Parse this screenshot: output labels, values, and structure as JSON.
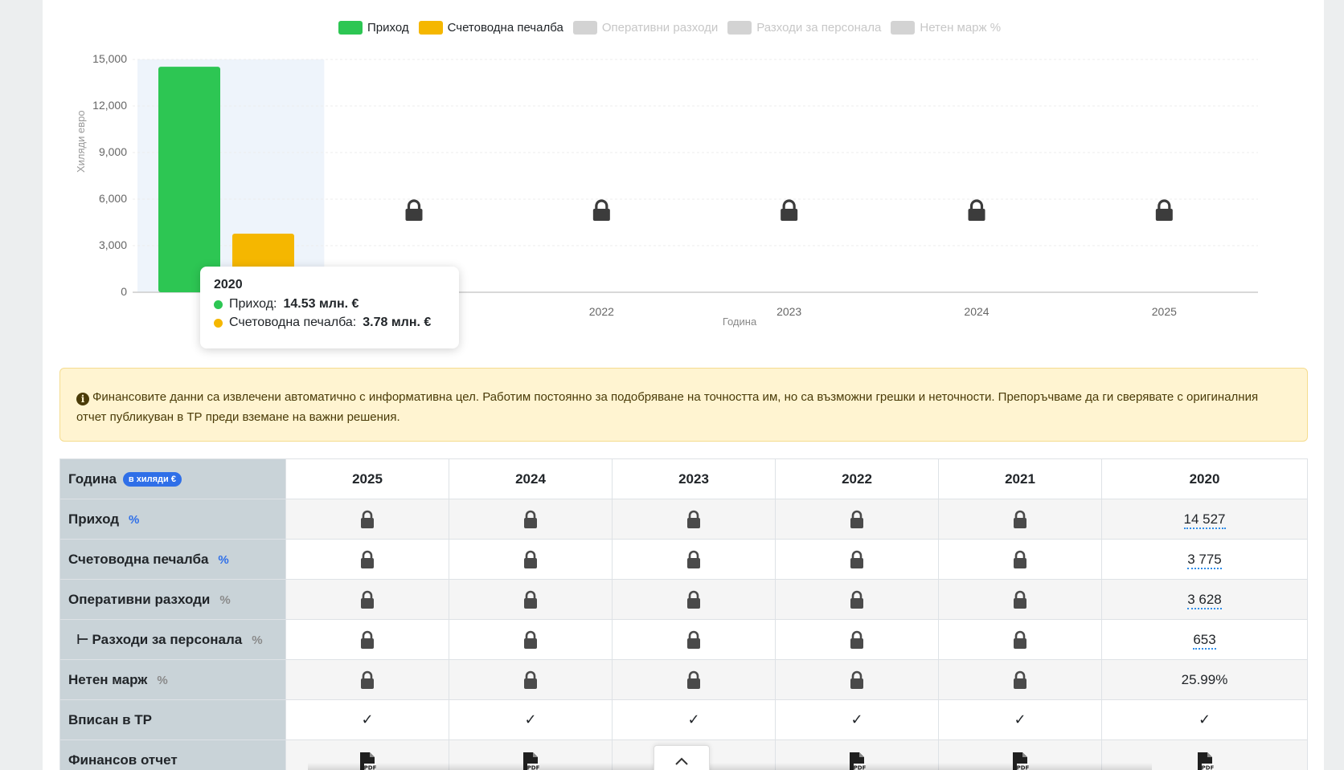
{
  "legend": [
    {
      "label": "Приход",
      "color": "#2dc653",
      "active": true
    },
    {
      "label": "Счетоводна печалба",
      "color": "#f5b700",
      "active": true
    },
    {
      "label": "Оперативни разходи",
      "color": "#d3d3d3",
      "active": false
    },
    {
      "label": "Разходи за персонала",
      "color": "#d3d3d3",
      "active": false
    },
    {
      "label": "Нетен марж %",
      "color": "#d3d3d3",
      "active": false
    }
  ],
  "chart_data": {
    "type": "bar",
    "categories": [
      "2020",
      "2021",
      "2022",
      "2023",
      "2024",
      "2025"
    ],
    "x_tick_labels": [
      "",
      "",
      "2022",
      "2023",
      "2024",
      "2025"
    ],
    "series": [
      {
        "name": "Приход",
        "values": [
          14527,
          null,
          null,
          null,
          null,
          null
        ],
        "color": "#2dc653"
      },
      {
        "name": "Счетоводна печалба",
        "values": [
          3775,
          null,
          null,
          null,
          null,
          null
        ],
        "color": "#f5b700"
      }
    ],
    "locked_categories": [
      "2021",
      "2022",
      "2023",
      "2024",
      "2025"
    ],
    "ylabel": "Хиляди евро",
    "xlabel": "Година",
    "ylim": [
      0,
      15000
    ],
    "yticks": [
      "0",
      "3,000",
      "6,000",
      "9,000",
      "12,000",
      "15,000"
    ],
    "grid": true,
    "legend_position": "top-center"
  },
  "tooltip": {
    "title": "2020",
    "rows": [
      {
        "label": "Приход:",
        "value": "14.53 млн. €",
        "color": "#2dc653"
      },
      {
        "label": "Счетоводна печалба:",
        "value": "3.78 млн. €",
        "color": "#f5b700"
      }
    ]
  },
  "notice": {
    "icon": "info-icon",
    "text": "Финансовите данни са извлечени автоматично с информативна цел. Работим постоянно за подобряване на точността им, но са възможни грешки и неточности. Препоръчваме да ги сверявате с оригиналния отчет публикуван в ТР преди вземане на важни решения."
  },
  "table": {
    "header_label": "Година",
    "badge": "в хиляди €",
    "years": [
      "2025",
      "2024",
      "2023",
      "2022",
      "2021",
      "2020"
    ],
    "rows": [
      {
        "label": "Приход",
        "icon": "percent-icon",
        "value_2020": "14 527"
      },
      {
        "label": "Счетоводна печалба",
        "icon": "percent-icon",
        "value_2020": "3 775"
      },
      {
        "label": "Оперативни разходи",
        "icon": "percent-icon",
        "value_2020": "3 628"
      },
      {
        "label": "Разходи за персонала",
        "icon": "percent-icon",
        "value_2020": "653"
      },
      {
        "label": "Нетен марж",
        "icon": "percent-icon",
        "value_2020": "25.99%"
      },
      {
        "label": "Вписан в ТР",
        "check": "✓"
      },
      {
        "label": "Финансов отчет",
        "file_icon": "pdf-icon"
      }
    ]
  },
  "pct_symbol": "%",
  "branch_symbol": "⊢"
}
